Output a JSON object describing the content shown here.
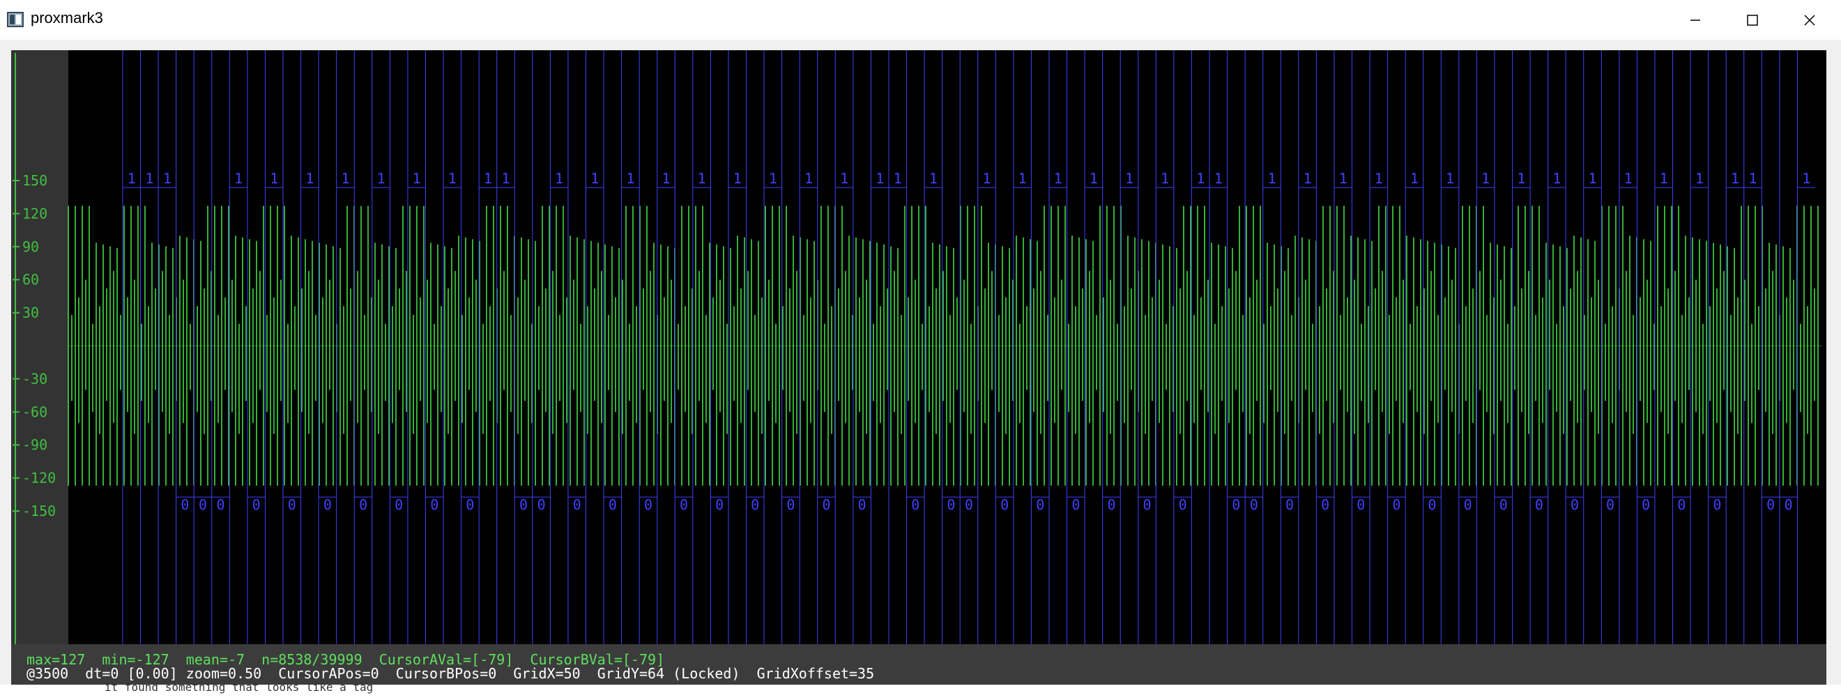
{
  "window": {
    "title": "proxmark3",
    "minimize_icon": "minimize-icon",
    "maximize_icon": "maximize-icon",
    "close_icon": "close-icon"
  },
  "colors": {
    "background": "#000000",
    "signal": "#44dd44",
    "axis": "#40c040",
    "grid": "#0c3a0c",
    "demod": "#4040ff",
    "status_bg": "#3c3c3c",
    "status_green": "#5ee05e",
    "status_white": "#ffffff"
  },
  "chart_data": {
    "type": "line",
    "title": "",
    "xlabel": "",
    "ylabel": "",
    "ylim": [
      -157,
      157
    ],
    "y_ticks": [
      150,
      120,
      90,
      60,
      30,
      -30,
      -60,
      -90,
      -120,
      -150
    ],
    "grid": true,
    "series": [
      {
        "values": "signal-oscillating-between-127-and-minus-127"
      }
    ],
    "demod_bits": [
      "1",
      "1",
      "1",
      "0",
      "0",
      "0",
      "1",
      "0",
      "1",
      "0",
      "1",
      "0",
      "1",
      "0",
      "1",
      "0",
      "1",
      "0",
      "1",
      "0",
      "1",
      "1",
      "0",
      "0",
      "1",
      "0",
      "1",
      "0",
      "1",
      "0",
      "1",
      "0",
      "1",
      "0",
      "1",
      "0",
      "1",
      "0",
      "1",
      "0",
      "1",
      "0",
      "1",
      "1",
      "0",
      "1",
      "0",
      "0",
      "1",
      "0",
      "1",
      "0",
      "1",
      "0",
      "1",
      "0",
      "1",
      "0",
      "1",
      "0",
      "1",
      "1",
      "0",
      "0",
      "1",
      "0",
      "1",
      "0",
      "1",
      "0",
      "1",
      "0",
      "1",
      "0",
      "1",
      "0",
      "1",
      "0",
      "1",
      "0",
      "1",
      "0",
      "1",
      "0",
      "1",
      "0",
      "1",
      "0",
      "1",
      "0",
      "1",
      "1",
      "0",
      "0",
      "1"
    ]
  },
  "status": {
    "line1": "max=127  min=-127  mean=-7  n=8538/39999  CursorAVal=[-79]  CursorBVal=[-79]",
    "line2": "@3500  dt=0 [0.00] zoom=0.50  CursorAPos=0  CursorBPos=0  GridX=50  GridY=64 (Locked)  GridXoffset=35"
  },
  "bottom_strip_text": "it found something that looks like a tag"
}
